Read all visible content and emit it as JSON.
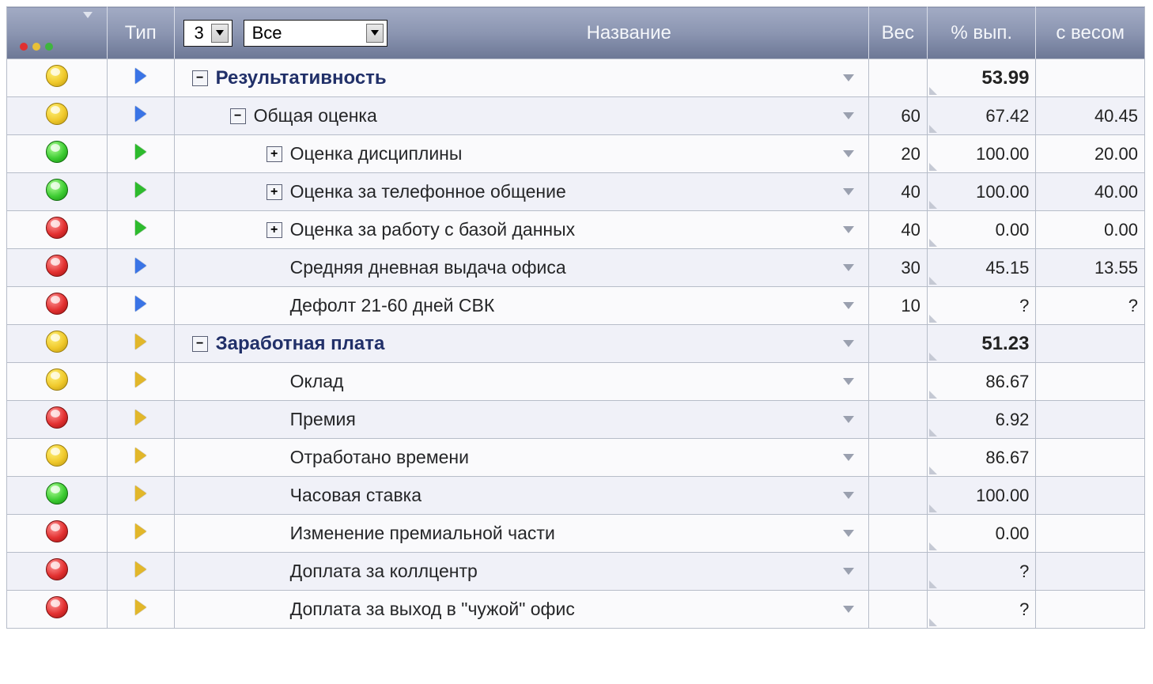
{
  "header": {
    "status_label": "",
    "type_label": "Тип",
    "name_label": "Название",
    "weight_label": "Вес",
    "pct_label": "% вып.",
    "weighted_label": "с весом",
    "level_select": "3",
    "filter_select": "Все"
  },
  "rows": [
    {
      "status": "yellow",
      "type": "blue",
      "indent": 0,
      "tree": "minus",
      "label": "Результативность",
      "bold": true,
      "weight": "",
      "pct": "53.99",
      "pct_bold": true,
      "w2": ""
    },
    {
      "status": "yellow",
      "type": "blue",
      "indent": 1,
      "tree": "minus",
      "label": "Общая оценка",
      "bold": false,
      "weight": "60",
      "pct": "67.42",
      "pct_bold": false,
      "w2": "40.45"
    },
    {
      "status": "green",
      "type": "green",
      "indent": 2,
      "tree": "plus",
      "label": "Оценка дисциплины",
      "bold": false,
      "weight": "20",
      "pct": "100.00",
      "pct_bold": false,
      "w2": "20.00"
    },
    {
      "status": "green",
      "type": "green",
      "indent": 2,
      "tree": "plus",
      "label": "Оценка за телефонное общение",
      "bold": false,
      "weight": "40",
      "pct": "100.00",
      "pct_bold": false,
      "w2": "40.00"
    },
    {
      "status": "red",
      "type": "green",
      "indent": 2,
      "tree": "plus",
      "label": "Оценка за работу с базой данных",
      "bold": false,
      "weight": "40",
      "pct": "0.00",
      "pct_bold": false,
      "w2": "0.00"
    },
    {
      "status": "red",
      "type": "blue",
      "indent": 2,
      "tree": "none",
      "label": "Средняя дневная выдача офиса",
      "bold": false,
      "weight": "30",
      "pct": "45.15",
      "pct_bold": false,
      "w2": "13.55"
    },
    {
      "status": "red",
      "type": "blue",
      "indent": 2,
      "tree": "none",
      "label": "Дефолт 21-60 дней СВК",
      "bold": false,
      "weight": "10",
      "pct": "?",
      "pct_bold": false,
      "w2": "?"
    },
    {
      "status": "yellow",
      "type": "yellow",
      "indent": 0,
      "tree": "minus",
      "label": "Заработная плата",
      "bold": true,
      "weight": "",
      "pct": "51.23",
      "pct_bold": true,
      "w2": ""
    },
    {
      "status": "yellow",
      "type": "yellow",
      "indent": 2,
      "tree": "none",
      "label": "Оклад",
      "bold": false,
      "weight": "",
      "pct": "86.67",
      "pct_bold": false,
      "w2": ""
    },
    {
      "status": "red",
      "type": "yellow",
      "indent": 2,
      "tree": "none",
      "label": "Премия",
      "bold": false,
      "weight": "",
      "pct": "6.92",
      "pct_bold": false,
      "w2": ""
    },
    {
      "status": "yellow",
      "type": "yellow",
      "indent": 2,
      "tree": "none",
      "label": "Отработано времени",
      "bold": false,
      "weight": "",
      "pct": "86.67",
      "pct_bold": false,
      "w2": ""
    },
    {
      "status": "green",
      "type": "yellow",
      "indent": 2,
      "tree": "none",
      "label": "Часовая ставка",
      "bold": false,
      "weight": "",
      "pct": "100.00",
      "pct_bold": false,
      "w2": ""
    },
    {
      "status": "red",
      "type": "yellow",
      "indent": 2,
      "tree": "none",
      "label": "Изменение премиальной части",
      "bold": false,
      "weight": "",
      "pct": "0.00",
      "pct_bold": false,
      "w2": ""
    },
    {
      "status": "red",
      "type": "yellow",
      "indent": 2,
      "tree": "none",
      "label": "Доплата за коллцентр",
      "bold": false,
      "weight": "",
      "pct": "?",
      "pct_bold": false,
      "w2": ""
    },
    {
      "status": "red",
      "type": "yellow",
      "indent": 2,
      "tree": "none",
      "label": "Доплата за выход в \"чужой\" офис",
      "bold": false,
      "weight": "",
      "pct": "?",
      "pct_bold": false,
      "w2": ""
    }
  ]
}
